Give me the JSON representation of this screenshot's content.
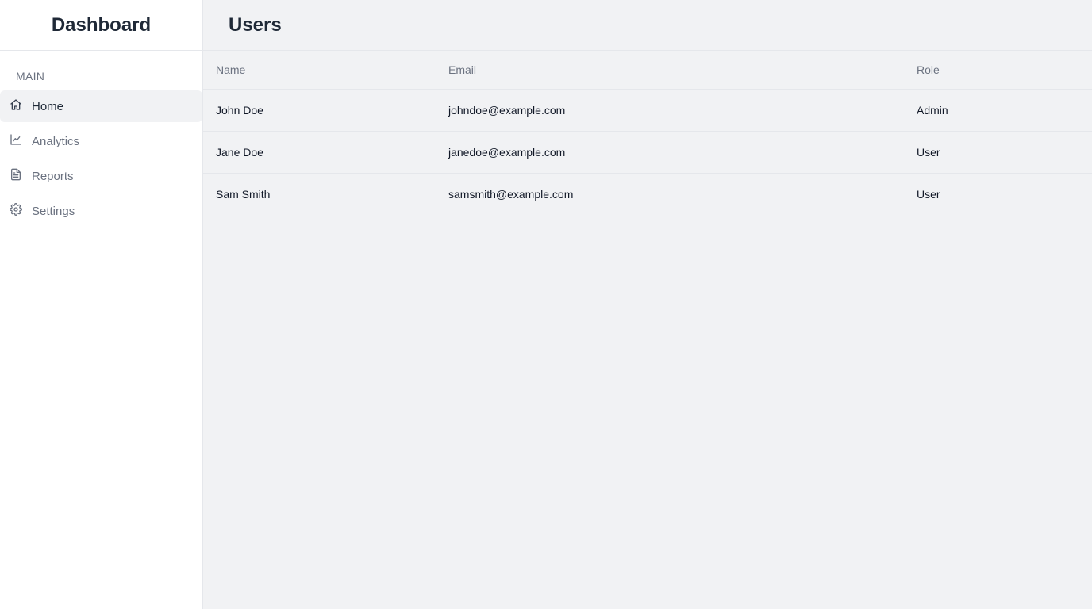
{
  "sidebar": {
    "brand": "Dashboard",
    "section_label": "MAIN",
    "items": [
      {
        "label": "Home",
        "icon": "home-icon"
      },
      {
        "label": "Analytics",
        "icon": "chart-line-icon"
      },
      {
        "label": "Reports",
        "icon": "document-icon"
      },
      {
        "label": "Settings",
        "icon": "gear-icon"
      }
    ],
    "active_item": "Home"
  },
  "main": {
    "title": "Users",
    "table": {
      "columns": [
        "Name",
        "Email",
        "Role"
      ],
      "rows": [
        [
          "John Doe",
          "johndoe@example.com",
          "Admin"
        ],
        [
          "Jane Doe",
          "janedoe@example.com",
          "User"
        ],
        [
          "Sam Smith",
          "samsmith@example.com",
          "User"
        ]
      ]
    }
  },
  "colors": {
    "sidebar_bg": "#ffffff",
    "main_bg": "#f1f2f4",
    "active_bg": "#f1f2f4",
    "muted_text": "#6b7280",
    "border": "#e5e7eb"
  }
}
